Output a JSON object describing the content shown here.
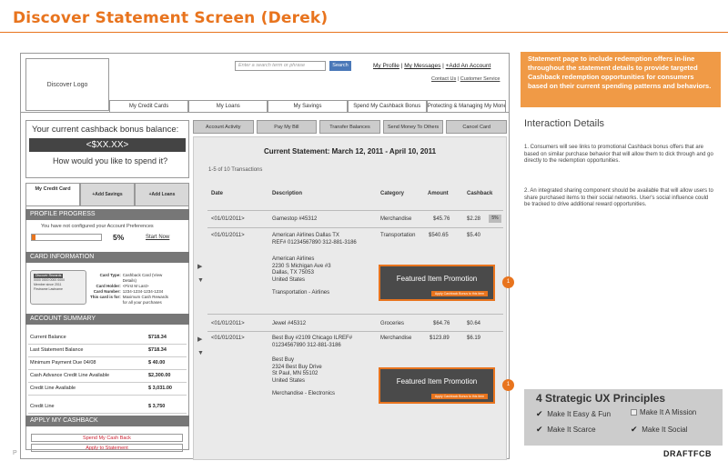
{
  "doc_title": "Discover Statement Screen (Derek)",
  "logo": "Discover Logo",
  "search": {
    "placeholder": "Enter a search term or phrase",
    "button": "Search"
  },
  "top_links": [
    "My Profile",
    "My Messages",
    "+Add An Account"
  ],
  "sub_links": [
    "Contact Us",
    "Customer Service"
  ],
  "nav": [
    "My Credit Cards",
    "My Loans",
    "My Savings",
    "Spend My Cashback Bonus",
    "Protecting & Managing My Money"
  ],
  "balance": {
    "label": "Your current cashback bonus balance:",
    "value": "<$XX.XX>",
    "question": "How would you like to spend it?"
  },
  "left_tabs": [
    {
      "label": "My Credit Card"
    },
    {
      "label": "+Add Savings"
    },
    {
      "label": "+Add Loans"
    }
  ],
  "profile": {
    "header": "PROFILE PROGRESS",
    "note": "You have not configured your Account Preferences",
    "percent": "5%",
    "progress": 0.05,
    "link": "Start Now"
  },
  "card_info": {
    "header": "CARD INFORMATION",
    "card_lines": [
      "Discover Rewards",
      "0000 0000 0000 0000",
      "Member since 2011",
      "Firstname Lastname"
    ],
    "rows": [
      {
        "k": "Card Type:",
        "v": "Cashback Card (View Details)"
      },
      {
        "k": "Card Holder:",
        "v": "<First M Last>"
      },
      {
        "k": "Card Number:",
        "v": "1234-1234-1234-1234"
      },
      {
        "k": "This card is for:",
        "v": "Maximum Cash Rewards for all your purchases"
      }
    ]
  },
  "account_summary": {
    "header": "ACCOUNT SUMMARY",
    "rows": [
      {
        "k": "Current Balance",
        "v": "$718.34"
      },
      {
        "k": "Last Statement Balance",
        "v": "$718.34"
      },
      {
        "k": "Minimum Payment Due 04/08",
        "v": "$ 40.00"
      },
      {
        "k": "Cash Advance Credit Line Available",
        "v": "$2,300.00"
      },
      {
        "k": "Credit Line Available",
        "v": "$ 3,031.00"
      },
      {
        "k": "Credit Line",
        "v": "$ 3,750"
      }
    ]
  },
  "apply_cashback": {
    "header": "APPLY MY CASHBACK",
    "buttons": [
      "Spend My Cash Back",
      "Apply to Statement"
    ]
  },
  "action_tabs": [
    "Account Activity",
    "Pay My Bill",
    "Transfer Balances",
    "Send Money To Others",
    "Cancel Card"
  ],
  "statement": {
    "title": "Current Statement: March 12, 2011 - April 10, 2011",
    "count": "1-5 of 10 Transactions",
    "columns": [
      "Date",
      "Description",
      "Category",
      "Amount",
      "Cashback"
    ],
    "rows": [
      {
        "date": "<01/01/2011>",
        "desc": "Gamestop #45312",
        "cat": "Merchandise",
        "amt": "$45.76",
        "cb": "$2.28",
        "badge": "5%"
      },
      {
        "date": "<01/01/2011>",
        "desc": "American Airlines Dallas TX",
        "desc2": "REF# 01234567890 312-881-3186",
        "cat": "Transportation",
        "amt": "$540.65",
        "cb": "$5.40",
        "detail": [
          "American Airlines",
          "2230 S Michigan Ave #3",
          "Dallas, TX 75053",
          "United States",
          "",
          "Transportation - Airlines"
        ]
      },
      {
        "date": "<01/01/2011>",
        "desc": "Jewel #45312",
        "cat": "Groceries",
        "amt": "$64.76",
        "cb": "$0.64"
      },
      {
        "date": "<01/01/2011>",
        "desc": "Best Buy #2109 Chicago ILREF#",
        "desc2": "01234567890 312-881-3186",
        "cat": "Merchandise",
        "amt": "$123.89",
        "cb": "$6.19",
        "detail": [
          "Best Buy",
          "2324 Best Buy Drive",
          "St Paul, MN 55102",
          "United States",
          "",
          "Merchandise - Electronics"
        ]
      }
    ]
  },
  "featured": {
    "title": "Featured Item Promotion",
    "button": "Apply Cashback Bonus to this item",
    "marker": "1"
  },
  "note": "Statement page to include redemption offers in-line throughout the statement details to provide targeted Cashback redemption opportunities for consumers based on their current spending patterns and behaviors.",
  "interaction": {
    "title": "Interaction Details",
    "p1": "1. Consumers will see links to  promotional Cashback bonus offers that are based on similar purchase behavior that will allow them to dick through and go directly to the redemption opportunities.",
    "p2": "2. An integrated sharing component should be available that will allow users to share purchased items to their social networks. User's social influence could be tracked to drive additional reward opportunities."
  },
  "ux": {
    "title": "4 Strategic UX Principles",
    "items": [
      "Make It Easy & Fun",
      "Make It A Mission",
      "Make It Scarce",
      "Make It Social"
    ]
  },
  "footer": {
    "page": "P",
    "brand": "DRAFTFCB"
  }
}
